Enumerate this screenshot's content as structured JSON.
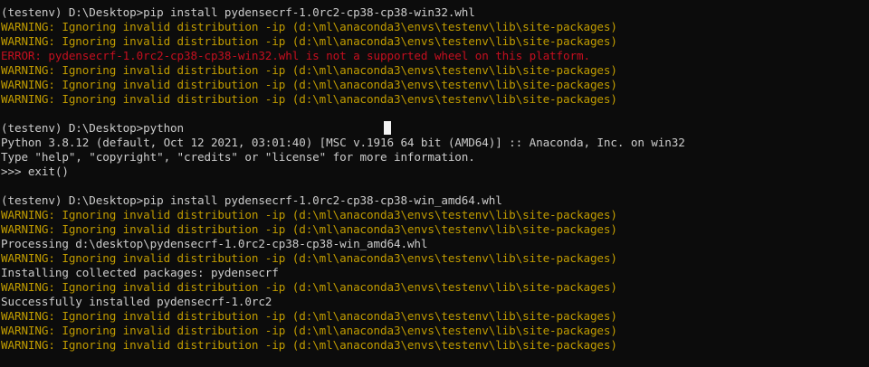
{
  "colors": {
    "background": "#0c0c0c",
    "normal": "#cccccc",
    "warning": "#c19c00",
    "error": "#c50f1f",
    "cursor": "#f2f2f2"
  },
  "lines": [
    {
      "text": "(testenv) D:\\Desktop>pip install pydensecrf-1.0rc2-cp38-cp38-win32.whl",
      "type": "normal"
    },
    {
      "text": "WARNING: Ignoring invalid distribution -ip (d:\\ml\\anaconda3\\envs\\testenv\\lib\\site-packages)",
      "type": "warning"
    },
    {
      "text": "WARNING: Ignoring invalid distribution -ip (d:\\ml\\anaconda3\\envs\\testenv\\lib\\site-packages)",
      "type": "warning"
    },
    {
      "text": "ERROR: pydensecrf-1.0rc2-cp38-cp38-win32.whl is not a supported wheel on this platform.",
      "type": "error"
    },
    {
      "text": "WARNING: Ignoring invalid distribution -ip (d:\\ml\\anaconda3\\envs\\testenv\\lib\\site-packages)",
      "type": "warning"
    },
    {
      "text": "WARNING: Ignoring invalid distribution -ip (d:\\ml\\anaconda3\\envs\\testenv\\lib\\site-packages)",
      "type": "warning"
    },
    {
      "text": "WARNING: Ignoring invalid distribution -ip (d:\\ml\\anaconda3\\envs\\testenv\\lib\\site-packages)",
      "type": "warning"
    },
    {
      "text": "",
      "type": "blank"
    },
    {
      "text": "(testenv) D:\\Desktop>python",
      "type": "normal"
    },
    {
      "text": "Python 3.8.12 (default, Oct 12 2021, 03:01:40) [MSC v.1916 64 bit (AMD64)] :: Anaconda, Inc. on win32",
      "type": "normal"
    },
    {
      "text": "Type \"help\", \"copyright\", \"credits\" or \"license\" for more information.",
      "type": "normal"
    },
    {
      "text": ">>> exit()",
      "type": "normal"
    },
    {
      "text": "",
      "type": "blank"
    },
    {
      "text": "(testenv) D:\\Desktop>pip install pydensecrf-1.0rc2-cp38-cp38-win_amd64.whl",
      "type": "normal"
    },
    {
      "text": "WARNING: Ignoring invalid distribution -ip (d:\\ml\\anaconda3\\envs\\testenv\\lib\\site-packages)",
      "type": "warning"
    },
    {
      "text": "WARNING: Ignoring invalid distribution -ip (d:\\ml\\anaconda3\\envs\\testenv\\lib\\site-packages)",
      "type": "warning"
    },
    {
      "text": "Processing d:\\desktop\\pydensecrf-1.0rc2-cp38-cp38-win_amd64.whl",
      "type": "normal"
    },
    {
      "text": "WARNING: Ignoring invalid distribution -ip (d:\\ml\\anaconda3\\envs\\testenv\\lib\\site-packages)",
      "type": "warning"
    },
    {
      "text": "Installing collected packages: pydensecrf",
      "type": "normal"
    },
    {
      "text": "WARNING: Ignoring invalid distribution -ip (d:\\ml\\anaconda3\\envs\\testenv\\lib\\site-packages)",
      "type": "warning"
    },
    {
      "text": "Successfully installed pydensecrf-1.0rc2",
      "type": "normal"
    },
    {
      "text": "WARNING: Ignoring invalid distribution -ip (d:\\ml\\anaconda3\\envs\\testenv\\lib\\site-packages)",
      "type": "warning"
    },
    {
      "text": "WARNING: Ignoring invalid distribution -ip (d:\\ml\\anaconda3\\envs\\testenv\\lib\\site-packages)",
      "type": "warning"
    },
    {
      "text": "WARNING: Ignoring invalid distribution -ip (d:\\ml\\anaconda3\\envs\\testenv\\lib\\site-packages)",
      "type": "warning"
    }
  ]
}
